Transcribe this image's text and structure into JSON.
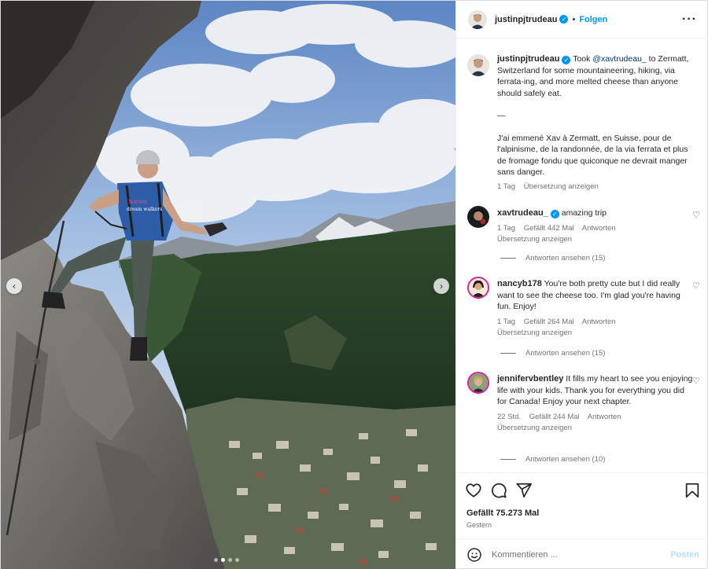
{
  "header": {
    "username": "justinpjtrudeau",
    "separator": "•",
    "follow_label": "Folgen",
    "more_icon": "more-horizontal-icon"
  },
  "caption": {
    "username": "justinpjtrudeau",
    "text_before_mention": "Took ",
    "mention": "@xavtrudeau_",
    "text_after_mention": " to Zermatt, Switzerland for some mountaineering, hiking, via ferrata-ing, and more melted cheese than anyone should safely eat.",
    "divider": "—",
    "french": "J'ai emmené Xav à Zermatt, en Suisse, pour de l'alpinisme, de la randonnée, de la via ferrata et plus de fromage fondu que quiconque ne devrait manger sans danger.",
    "time": "1 Tag",
    "translate": "Übersetzung anzeigen"
  },
  "comments": [
    {
      "username": "xavtrudeau_",
      "verified": true,
      "text": "amazing trip",
      "time": "1 Tag",
      "likes": "Gefällt 442 Mal",
      "reply": "Antworten",
      "translate": "Übersetzung anzeigen",
      "view_replies": "Antworten ansehen (15)"
    },
    {
      "username": "nancyb178",
      "verified": false,
      "text": "You're both pretty cute but I did really want to see the cheese too. I'm glad you're having fun. Enjoy!",
      "time": "1 Tag",
      "likes": "Gefällt 264 Mal",
      "reply": "Antworten",
      "translate": "Übersetzung anzeigen",
      "view_replies": "Antworten ansehen (15)"
    },
    {
      "username": "jennifervbentley",
      "verified": false,
      "text": "It fills my heart to see you enjoying life with your kids. Thank you for everything you did for Canada! Enjoy your next chapter.",
      "time": "22 Std.",
      "likes": "Gefällt 244 Mal",
      "reply": "Antworten",
      "translate": "Übersetzung anzeigen",
      "view_replies": "Antworten ansehen (10)"
    }
  ],
  "actions": {
    "likes": "Gefällt 75.273 Mal",
    "date": "Gestern"
  },
  "composer": {
    "placeholder": "Kommentieren ...",
    "post_label": "Posten"
  },
  "photo": {
    "shirt_text_1": "Nation",
    "shirt_text_2": "dream walkers"
  },
  "colors": {
    "accent": "#0095f6",
    "link": "#00376b",
    "muted": "#737373",
    "post_disabled": "#b2dffc"
  }
}
